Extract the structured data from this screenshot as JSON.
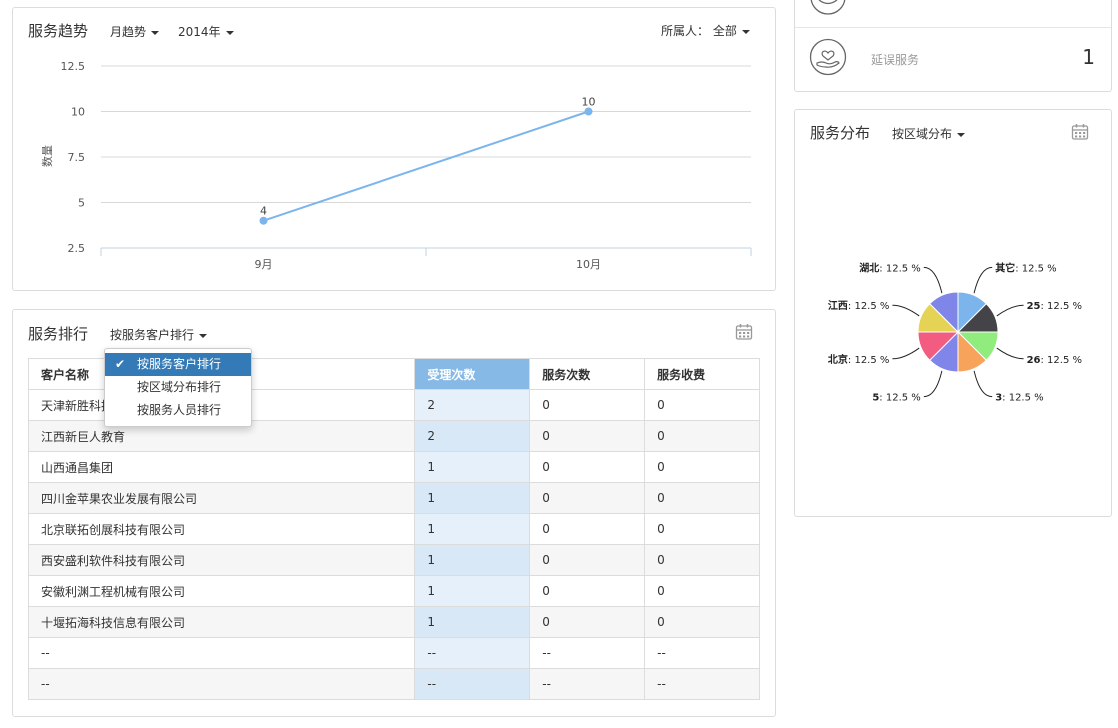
{
  "trend": {
    "title": "服务趋势",
    "period_select": "月趋势",
    "year_select": "2014年",
    "owner_label": "所属人：",
    "owner_select": "全部"
  },
  "ranking": {
    "title": "服务排行",
    "sort_select": "按服务客户排行",
    "menu_options": [
      "按服务客户排行",
      "按区域分布排行",
      "按服务人员排行"
    ],
    "columns": [
      "客户名称",
      "受理次数",
      "服务次数",
      "服务收费"
    ],
    "rows": [
      [
        "天津新胜科技",
        "2",
        "0",
        "0"
      ],
      [
        "江西新巨人教育",
        "2",
        "0",
        "0"
      ],
      [
        "山西通昌集团",
        "1",
        "0",
        "0"
      ],
      [
        "四川金苹果农业发展有限公司",
        "1",
        "0",
        "0"
      ],
      [
        "北京联拓创展科技有限公司",
        "1",
        "0",
        "0"
      ],
      [
        "西安盛利软件科技有限公司",
        "1",
        "0",
        "0"
      ],
      [
        "安徽利渊工程机械有限公司",
        "1",
        "0",
        "0"
      ],
      [
        "十堰拓海科技信息有限公司",
        "1",
        "0",
        "0"
      ],
      [
        "--",
        "--",
        "--",
        "--"
      ],
      [
        "--",
        "--",
        "--",
        "--"
      ]
    ]
  },
  "stats": {
    "delayed_label": "延误服务",
    "delayed_value": "1"
  },
  "distribution": {
    "title": "服务分布",
    "group_select": "按区域分布"
  },
  "colors": {
    "line": "#7cb5ec",
    "table_header_highlight": "#86b9e6",
    "menu_active": "#337ab7"
  },
  "icons": [
    "calendar-icon",
    "service-hand-icon",
    "check-icon",
    "caret-down-icon"
  ],
  "chart_data": [
    {
      "type": "line",
      "categories": [
        "9月",
        "10月"
      ],
      "series": [
        {
          "values": [
            4,
            10
          ]
        }
      ],
      "ylabel": "数量",
      "yticks": [
        2.5,
        5,
        7.5,
        10,
        12.5
      ],
      "ylim": [
        2.5,
        12.5
      ],
      "grid": true,
      "data_labels": true
    },
    {
      "type": "pie",
      "slices": [
        {
          "label": "其它",
          "value": 12.5,
          "display": ": 12.5 %",
          "color": "#7cb5ec"
        },
        {
          "label": "25",
          "value": 12.5,
          "display": ": 12.5 %",
          "color": "#434348"
        },
        {
          "label": "26",
          "value": 12.5,
          "display": ": 12.5 %",
          "color": "#90ed7d"
        },
        {
          "label": "3",
          "value": 12.5,
          "display": ": 12.5 %",
          "color": "#f7a35c"
        },
        {
          "label": "5",
          "value": 12.5,
          "display": ": 12.5 %",
          "color": "#8085e9"
        },
        {
          "label": "北京",
          "value": 12.5,
          "display": ": 12.5 %",
          "color": "#f15c80"
        },
        {
          "label": "江西",
          "value": 12.5,
          "display": ": 12.5 %",
          "color": "#e4d354"
        },
        {
          "label": "湖北",
          "value": 12.5,
          "display": ": 12.5 %",
          "color": "#8085e8"
        }
      ]
    }
  ]
}
